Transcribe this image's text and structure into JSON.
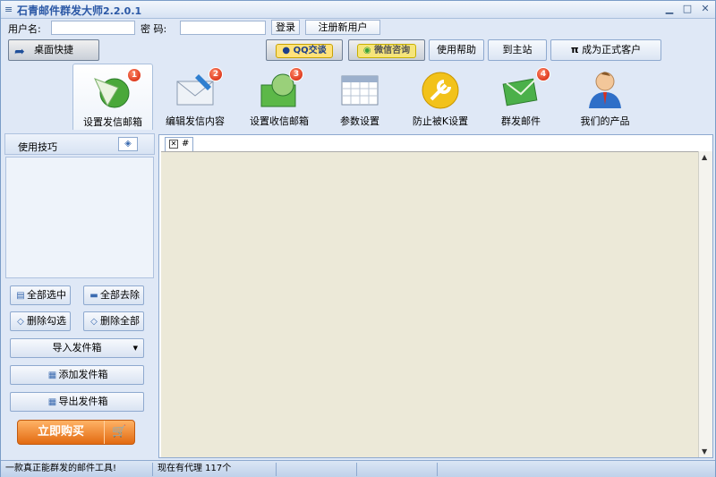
{
  "window": {
    "title": "石青邮件群发大师",
    "version": "2.2.0.1"
  },
  "login": {
    "username_label": "用户名:",
    "username_value": "",
    "password_label": "密   码:",
    "password_value": "",
    "login_button": "登录",
    "register_button": "注册新用户"
  },
  "toolbar": {
    "desktop_shortcut": "桌面快捷",
    "qq_chat": "QQ交谈",
    "wechat_consult": "微信咨询",
    "help": "使用帮助",
    "home_site": "到主站",
    "become_customer": "成为正式客户",
    "pi_symbol": "π"
  },
  "tabs": [
    {
      "label": "设置发信邮箱",
      "badge": "1",
      "icon": "mail-globe-icon"
    },
    {
      "label": "编辑发信内容",
      "badge": "2",
      "icon": "envelope-pen-icon"
    },
    {
      "label": "设置收信邮箱",
      "badge": "3",
      "icon": "inbox-globe-icon"
    },
    {
      "label": "参数设置",
      "badge": "",
      "icon": "calendar-grid-icon"
    },
    {
      "label": "防止被K设置",
      "badge": "",
      "icon": "wrench-icon"
    },
    {
      "label": "群发邮件",
      "badge": "4",
      "icon": "send-mail-icon"
    },
    {
      "label": "我们的产品",
      "badge": "",
      "icon": "person-icon"
    }
  ],
  "left_panel": {
    "tips_title": "使用技巧",
    "select_all": "全部选中",
    "remove_all": "全部去除",
    "delete_checked": "删除勾选",
    "delete_all": "删除全部",
    "import_sender": "导入发件箱",
    "add_sender": "添加发件箱",
    "export_sender": "导出发件箱",
    "buy_now": "立即购买"
  },
  "doc_tab": {
    "label": "#"
  },
  "status": {
    "slogan": "一款真正能群发的邮件工具!",
    "proxy": "现在有代理 117个"
  }
}
